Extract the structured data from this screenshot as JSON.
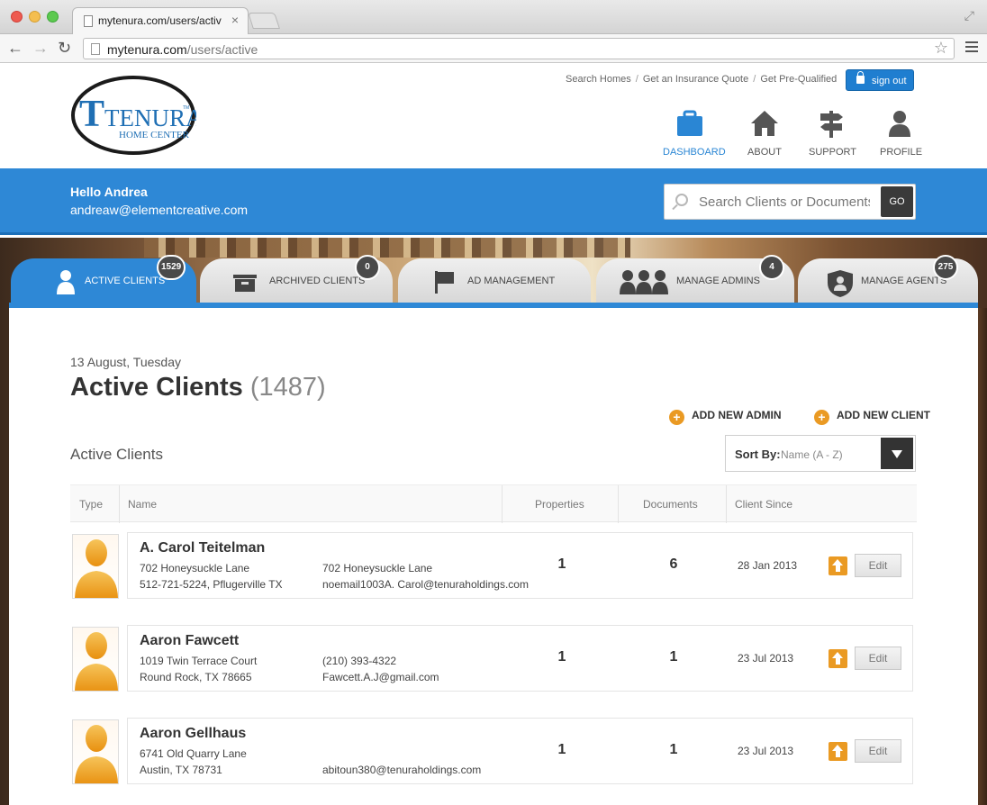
{
  "browser": {
    "tab_title": "mytenura.com/users/activ",
    "tab_close": "×",
    "url_host": "mytenura.com",
    "url_path": "/users/active",
    "star": "☆"
  },
  "header": {
    "logo_text": "TENURA",
    "logo_sub": "HOME CENTER",
    "logo_tm": "TM",
    "top_links": [
      "Search Homes",
      "Get an Insurance Quote",
      "Get Pre-Qualified"
    ],
    "link_separator": "/",
    "signout_label": "sign out",
    "nav": [
      {
        "label": "DASHBOARD",
        "icon": "briefcase-icon",
        "active": true
      },
      {
        "label": "ABOUT",
        "icon": "home-icon",
        "active": false
      },
      {
        "label": "SUPPORT",
        "icon": "signpost-icon",
        "active": false
      },
      {
        "label": "PROFILE",
        "icon": "person-icon",
        "active": false
      }
    ]
  },
  "welcome": {
    "greeting": "Hello Andrea",
    "email": "andreaw@elementcreative.com",
    "search_placeholder": "Search Clients or Documents",
    "go_label": "GO"
  },
  "tabs": [
    {
      "label": "ACTIVE CLIENTS",
      "badge": "1529",
      "active": true,
      "icon": "person-icon"
    },
    {
      "label": "ARCHIVED CLIENTS",
      "badge": "0",
      "active": false,
      "icon": "archive-box-icon"
    },
    {
      "label": "AD MANAGEMENT",
      "badge": "",
      "active": false,
      "icon": "flag-icon"
    },
    {
      "label": "MANAGE ADMINS",
      "badge": "4",
      "active": false,
      "icon": "group-icon"
    },
    {
      "label": "MANAGE AGENTS",
      "badge": "275",
      "active": false,
      "icon": "agent-shield-icon"
    }
  ],
  "content": {
    "date": "13 August, Tuesday",
    "title": "Active Clients",
    "title_count": "(1487)",
    "add_admin": "ADD NEW ADMIN",
    "add_client": "ADD NEW CLIENT",
    "section_title": "Active Clients",
    "sort_label": "Sort By:",
    "sort_value": "Name (A - Z)",
    "columns": [
      "Type",
      "Name",
      "Properties",
      "Documents",
      "Client Since"
    ],
    "edit_label": "Edit",
    "clients": [
      {
        "name": "A. Carol Teitelman",
        "line1_left": "702 Honeysuckle Lane",
        "line2_left": "512-721-5224, Pflugerville TX",
        "line1_right": "702 Honeysuckle Lane",
        "line2_right": "noemail1003A. Carol@tenuraholdings.com",
        "properties": "1",
        "documents": "6",
        "since": "28 Jan 2013"
      },
      {
        "name": "Aaron Fawcett",
        "line1_left": "1019 Twin Terrace Court",
        "line2_left": "Round Rock, TX 78665",
        "line1_right": "(210) 393-4322",
        "line2_right": "Fawcett.A.J@gmail.com",
        "properties": "1",
        "documents": "1",
        "since": "23 Jul 2013"
      },
      {
        "name": "Aaron Gellhaus",
        "line1_left": "6741 Old Quarry Lane",
        "line2_left": "Austin, TX 78731",
        "line1_right": "",
        "line2_right": "abitoun380@tenuraholdings.com",
        "properties": "1",
        "documents": "1",
        "since": "23 Jul 2013"
      }
    ]
  },
  "colors": {
    "brand_blue": "#2e88d6",
    "accent_orange": "#ea9a23",
    "dark": "#333333"
  }
}
